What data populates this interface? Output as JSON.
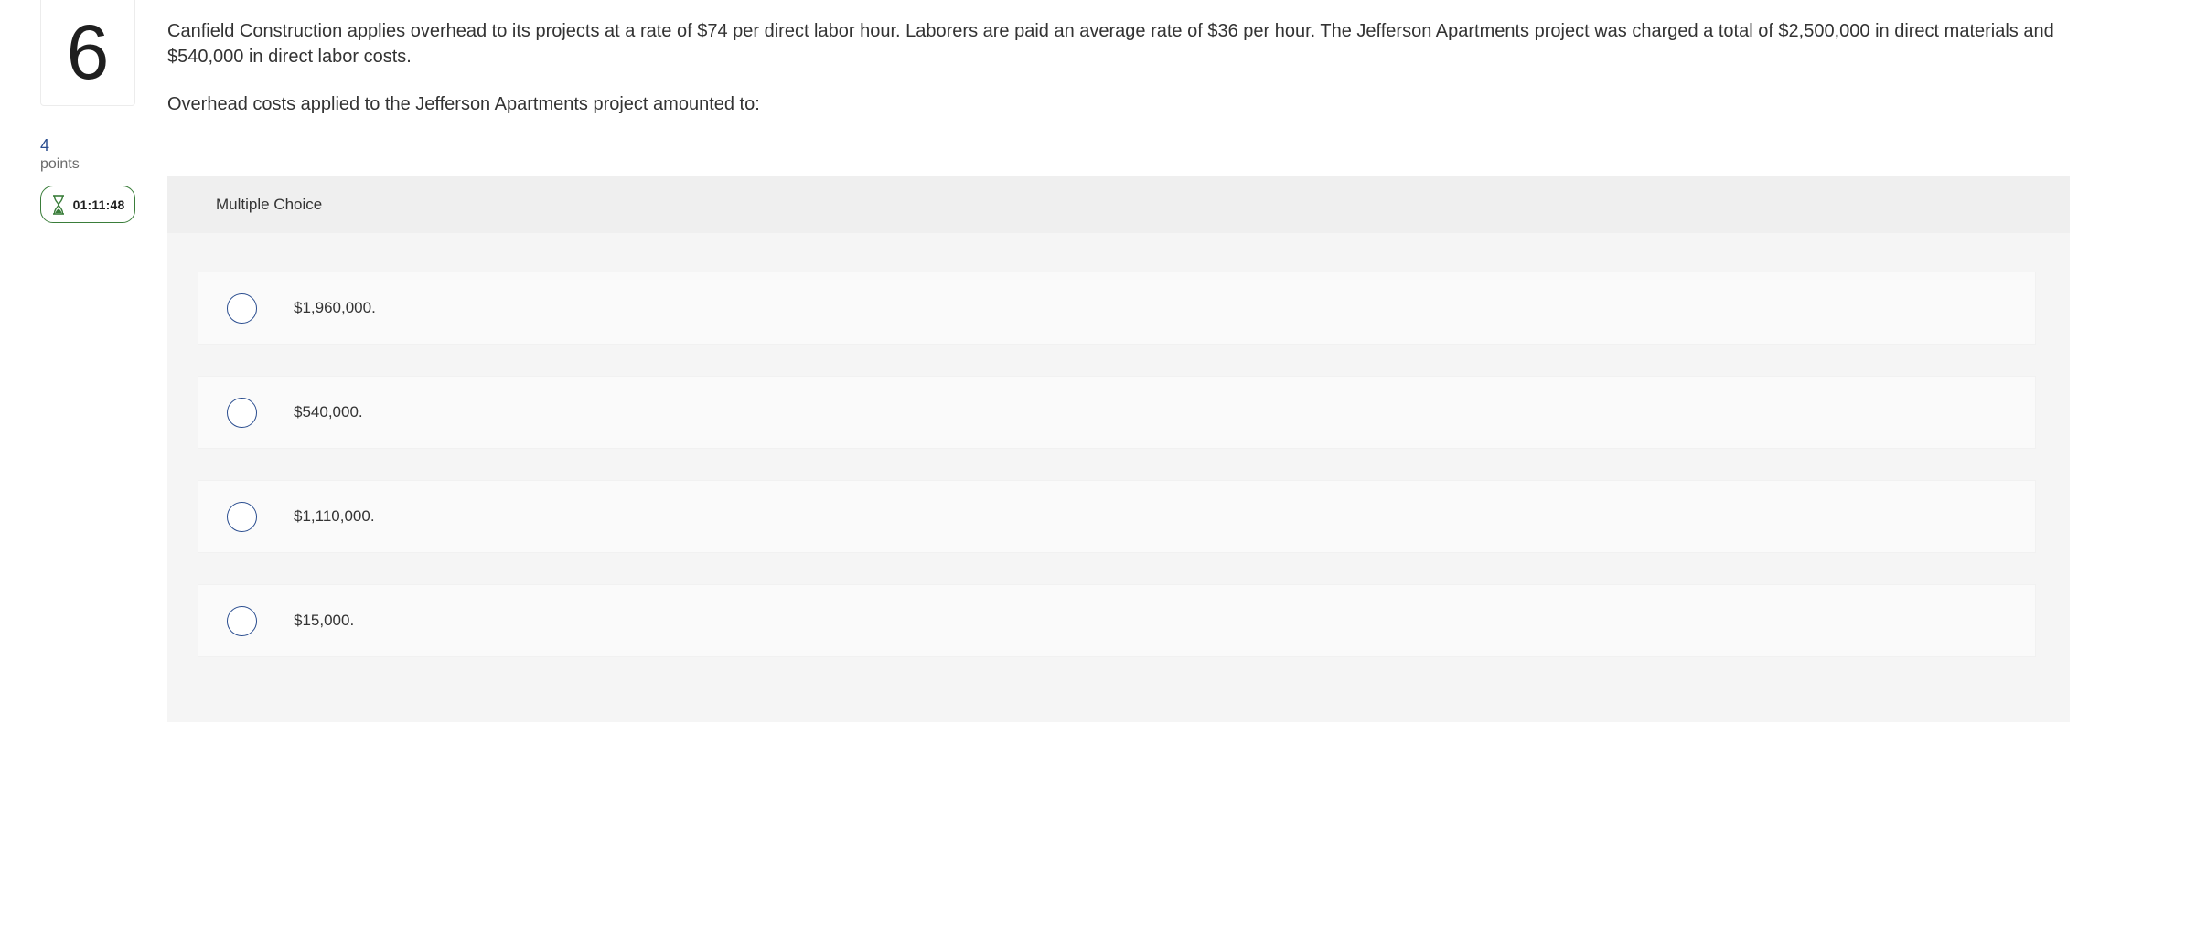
{
  "question": {
    "number": "6",
    "points_value": "4",
    "points_label": "points",
    "timer": "01:11:48",
    "prompt_text": "Canfield Construction applies overhead to its projects at a rate of $74 per direct labor hour. Laborers are paid an average rate of $36 per hour. The Jefferson Apartments project was charged a total of $2,500,000 in direct materials and $540,000 in direct labor costs.",
    "question_text": "Overhead costs applied to the Jefferson Apartments project amounted to:"
  },
  "multiple_choice": {
    "header": "Multiple Choice",
    "options": [
      {
        "label": "$1,960,000."
      },
      {
        "label": "$540,000."
      },
      {
        "label": "$1,110,000."
      },
      {
        "label": "$15,000."
      }
    ]
  },
  "icons": {
    "timer_icon": "hourglass-icon",
    "option_icon": "radio-button"
  },
  "colors": {
    "accent_blue": "#2a4d8f",
    "timer_green": "#3a7d3a",
    "panel_bg": "#f5f5f5",
    "header_bg": "#efefef"
  }
}
